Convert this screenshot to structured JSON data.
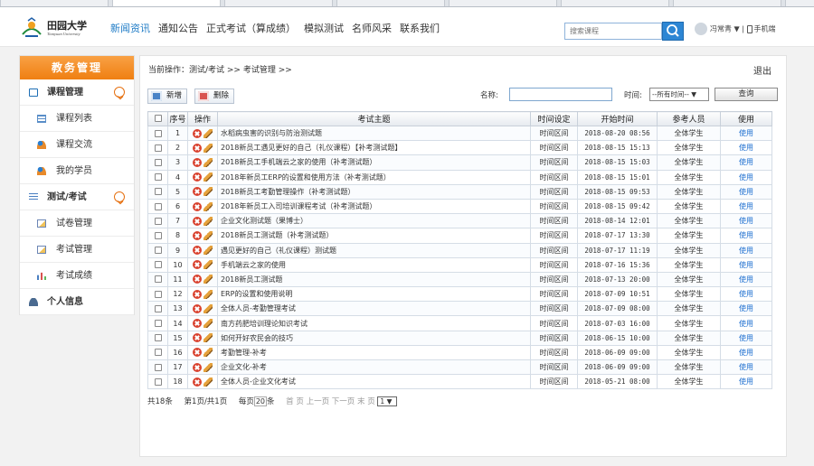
{
  "header": {
    "logo_cn": "田园大学",
    "logo_en": "Tianyuan University",
    "nav": [
      "新闻资讯",
      "通知公告",
      "正式考试（算成绩）",
      "模拟测试",
      "名师风采",
      "联系我们"
    ],
    "active_nav": 0,
    "search_placeholder": "搜索课程",
    "user_name": "冯常青",
    "user_caret": "▼",
    "mobile": "手机端"
  },
  "sidebar": {
    "title": "教务管理",
    "items": [
      {
        "label": "课程管理",
        "type": "group",
        "icon": "book-icon",
        "expanded": true
      },
      {
        "label": "课程列表",
        "type": "sub",
        "icon": "list-icon"
      },
      {
        "label": "课程交流",
        "type": "sub",
        "icon": "people-icon"
      },
      {
        "label": "我的学员",
        "type": "sub",
        "icon": "people-icon"
      },
      {
        "label": "测试/考试",
        "type": "group",
        "icon": "lines-icon",
        "expanded": true
      },
      {
        "label": "试卷管理",
        "type": "sub",
        "icon": "paper-icon"
      },
      {
        "label": "考试管理",
        "type": "sub",
        "icon": "paper-icon"
      },
      {
        "label": "考试成绩",
        "type": "sub",
        "icon": "bars-icon"
      },
      {
        "label": "个人信息",
        "type": "group",
        "icon": "person-icon"
      }
    ]
  },
  "main": {
    "breadcrumb": "当前操作：测试/考试 >> 考试管理 >>",
    "logout": "退出",
    "toolbar": {
      "add_label": "新增",
      "delete_label": "删除",
      "name_label": "名称:",
      "name_value": "",
      "time_label": "时间:",
      "time_value": "--所有时间--",
      "time_caret": "▼",
      "query_label": "查询"
    },
    "table": {
      "headers": [
        "",
        "序号",
        "操作",
        "考试主题",
        "时间设定",
        "开始时间",
        "参考人员",
        "使用"
      ],
      "rows": [
        {
          "no": "1",
          "subject": "水稻病虫害的识别与防治测试题",
          "time_setting": "时间区间",
          "start": "2018-08-20 08:56",
          "participants": "全体学生",
          "use": "使用"
        },
        {
          "no": "2",
          "subject": "2018新员工遇见更好的自己（礼仪课程）【补考测试题】",
          "time_setting": "时间区间",
          "start": "2018-08-15 15:13",
          "participants": "全体学生",
          "use": "使用"
        },
        {
          "no": "3",
          "subject": "2018新员工手机端云之家的使用（补考测试题）",
          "time_setting": "时间区间",
          "start": "2018-08-15 15:03",
          "participants": "全体学生",
          "use": "使用"
        },
        {
          "no": "4",
          "subject": "2018年新员工ERP的设置和使用方法（补考测试题）",
          "time_setting": "时间区间",
          "start": "2018-08-15 15:01",
          "participants": "全体学生",
          "use": "使用"
        },
        {
          "no": "5",
          "subject": "2018新员工考勤管理操作（补考测试题）",
          "time_setting": "时间区间",
          "start": "2018-08-15 09:53",
          "participants": "全体学生",
          "use": "使用"
        },
        {
          "no": "6",
          "subject": "2018年新员工入司培训课程考试（补考测试题）",
          "time_setting": "时间区间",
          "start": "2018-08-15 09:42",
          "participants": "全体学生",
          "use": "使用"
        },
        {
          "no": "7",
          "subject": "企业文化测试题（果博士）",
          "time_setting": "时间区间",
          "start": "2018-08-14 12:01",
          "participants": "全体学生",
          "use": "使用"
        },
        {
          "no": "8",
          "subject": "2018新员工测试题（补考测试题）",
          "time_setting": "时间区间",
          "start": "2018-07-17 13:30",
          "participants": "全体学生",
          "use": "使用"
        },
        {
          "no": "9",
          "subject": "遇见更好的自己（礼仪课程）测试题",
          "time_setting": "时间区间",
          "start": "2018-07-17 11:19",
          "participants": "全体学生",
          "use": "使用"
        },
        {
          "no": "10",
          "subject": "手机端云之家的使用",
          "time_setting": "时间区间",
          "start": "2018-07-16 15:36",
          "participants": "全体学生",
          "use": "使用"
        },
        {
          "no": "11",
          "subject": "2018新员工测试题",
          "time_setting": "时间区间",
          "start": "2018-07-13 20:00",
          "participants": "全体学生",
          "use": "使用"
        },
        {
          "no": "12",
          "subject": "ERP的设置和使用说明",
          "time_setting": "时间区间",
          "start": "2018-07-09 10:51",
          "participants": "全体学生",
          "use": "使用"
        },
        {
          "no": "13",
          "subject": "全体人员-考勤管理考试",
          "time_setting": "时间区间",
          "start": "2018-07-09 08:00",
          "participants": "全体学生",
          "use": "使用"
        },
        {
          "no": "14",
          "subject": "南方药肥培训理论知识考试",
          "time_setting": "时间区间",
          "start": "2018-07-03 16:00",
          "participants": "全体学生",
          "use": "使用"
        },
        {
          "no": "15",
          "subject": "如何开好农民会的技巧",
          "time_setting": "时间区间",
          "start": "2018-06-15 10:00",
          "participants": "全体学生",
          "use": "使用"
        },
        {
          "no": "16",
          "subject": "考勤管理-补考",
          "time_setting": "时间区间",
          "start": "2018-06-09 09:00",
          "participants": "全体学生",
          "use": "使用"
        },
        {
          "no": "17",
          "subject": "企业文化-补考",
          "time_setting": "时间区间",
          "start": "2018-06-09 09:00",
          "participants": "全体学生",
          "use": "使用"
        },
        {
          "no": "18",
          "subject": "全体人员-企业文化考试",
          "time_setting": "时间区间",
          "start": "2018-05-21 08:00",
          "participants": "全体学生",
          "use": "使用"
        }
      ]
    },
    "pager": {
      "total": "共18条",
      "page_info": "第1页/共1页",
      "per_page_prefix": "每页",
      "per_page": "20",
      "per_page_suffix": "条",
      "first": "首 页",
      "prev": "上一页",
      "next": "下一页",
      "last": "末 页",
      "page_select": "1"
    }
  },
  "colors": {
    "accent": "#f39023",
    "link": "#1e6fd0",
    "nav_active": "#1e7bc6"
  }
}
